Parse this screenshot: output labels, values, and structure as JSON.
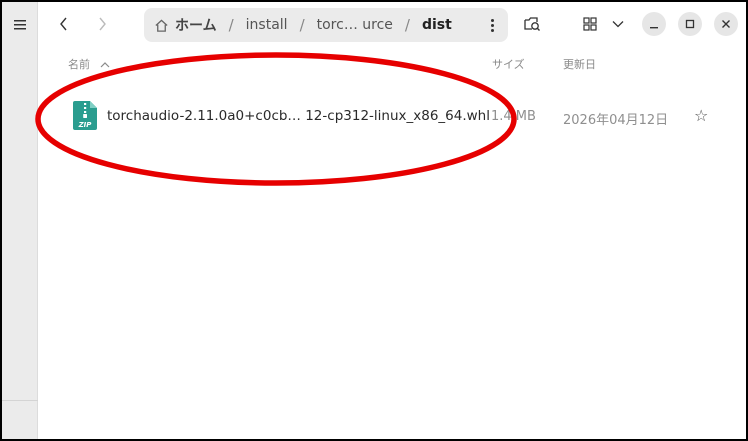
{
  "header": {
    "back_icon": "chevron-left",
    "forward_icon": "chevron-right",
    "breadcrumbs": [
      {
        "label": "ホーム",
        "icon": "home-icon"
      },
      {
        "label": "install"
      },
      {
        "label": "torc… urce"
      },
      {
        "label": "dist"
      }
    ],
    "separator": "/"
  },
  "columns": {
    "name": "名前",
    "size": "サイズ",
    "modified": "更新日"
  },
  "files": [
    {
      "name": "torchaudio-2.11.0a0+c0cb… 12-cp312-linux_x86_64.whl",
      "size": "1.4 MB",
      "modified": "2026年04月12日",
      "icon": "zip-archive-icon",
      "icon_label": "ZIP"
    }
  ],
  "colors": {
    "annotation": "#e60000",
    "zip_icon": "#2a9d8f"
  }
}
